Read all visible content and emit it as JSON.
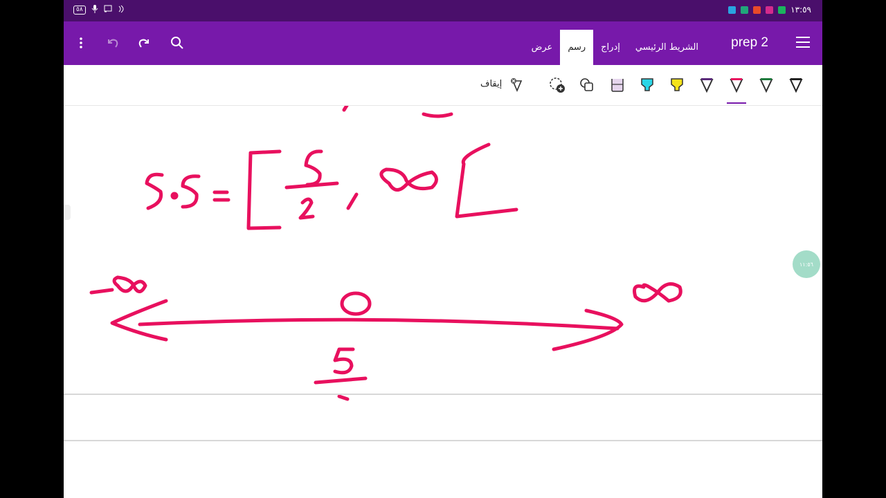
{
  "status_bar": {
    "battery": "٥٨",
    "time": "١٣:٥٩",
    "icons": [
      "battery-icon",
      "mic-icon",
      "cast-icon",
      "nfc-icon",
      "telegram-icon",
      "meet-icon",
      "office-icon",
      "video-icon",
      "facetime-icon"
    ]
  },
  "app_bar": {
    "notebook_title": "prep 2",
    "tabs": [
      {
        "label": "الشريط الرئيسي",
        "active": false
      },
      {
        "label": "إدراج",
        "active": false
      },
      {
        "label": "رسم",
        "active": true
      },
      {
        "label": "عرض",
        "active": false
      }
    ],
    "icons": [
      "hamburger-icon",
      "search-icon",
      "redo-icon",
      "undo-icon",
      "more-icon"
    ]
  },
  "toolbar": {
    "tools": [
      "pen-black",
      "pen-green",
      "pen-pink",
      "pen-purple",
      "highlighter-yellow",
      "highlighter-cyan",
      "highlighter-lavender",
      "shapes",
      "lasso-add"
    ],
    "stop_label": "إيقاف",
    "colors": {
      "accent": "#7719aa",
      "ink": "#e8105e"
    }
  },
  "canvas": {
    "time_badge": "١١:٥٦"
  }
}
